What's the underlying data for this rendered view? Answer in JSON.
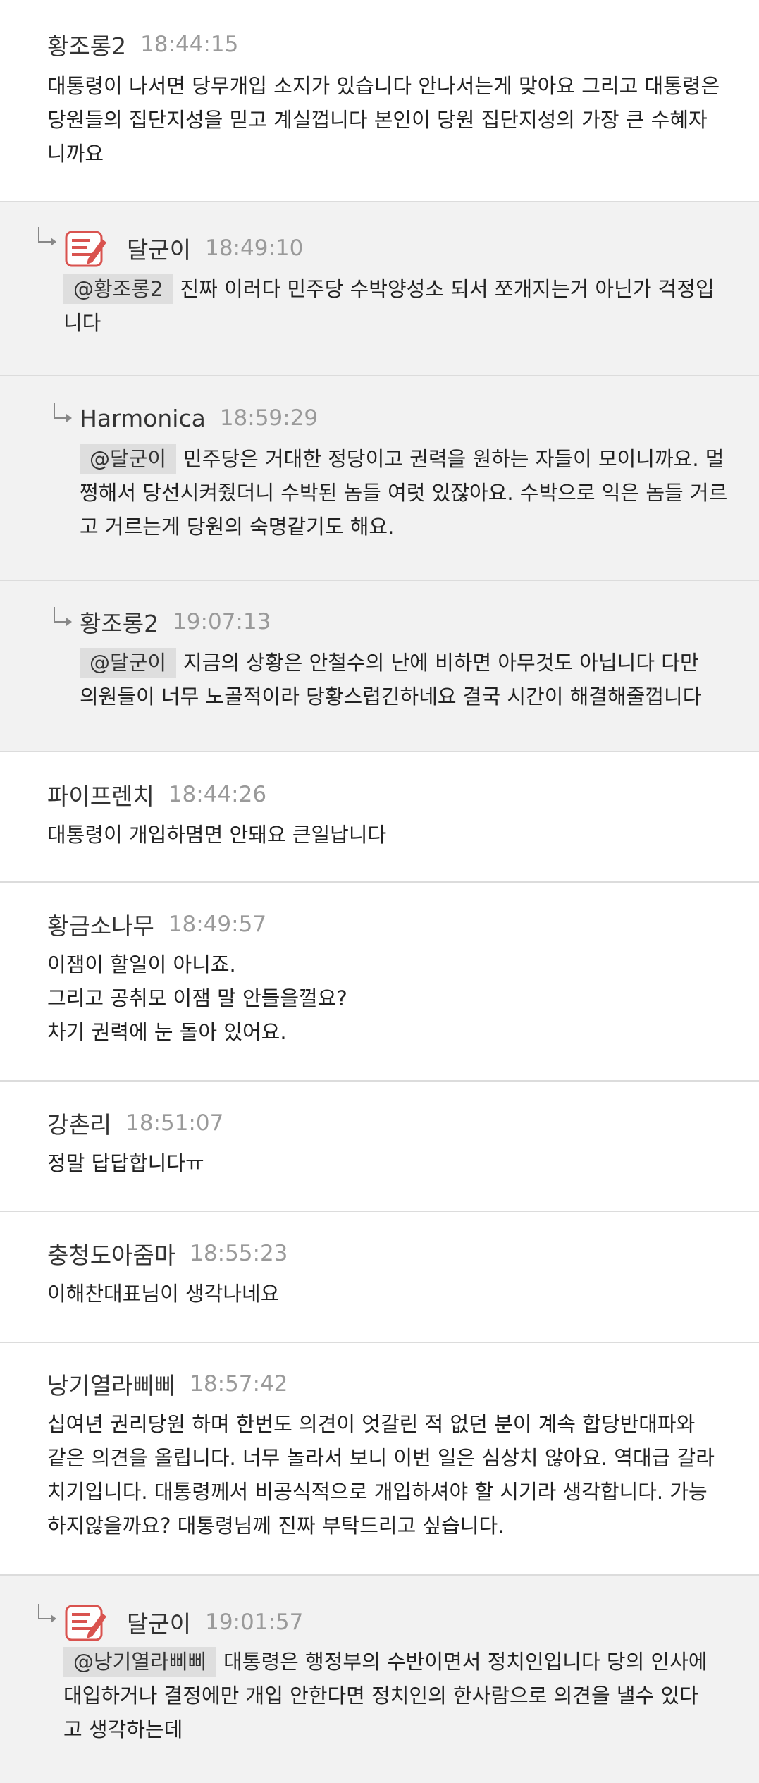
{
  "read_progress": 0.454,
  "accent_color": "#1eaa3b",
  "comments": [
    {
      "author": "황조롱2",
      "time": "18:44:15",
      "lines": [
        "대통령이 나서면 당무개입 소지가 있습니다 안나서는게 맞아요 그리고 대통령은",
        "당원들의 집단지성을 믿고 계실껍니다 본인이 당원 집단지성의 가장 큰 수혜자",
        "니까요"
      ]
    },
    {
      "author": "달군이",
      "badge_icon": "author-badge-icon",
      "time": "18:49:10",
      "mention": "@황조롱2",
      "first_line": "진짜 이러다 민주당 수박양성소 되서 쪼개지는거 아닌가 걱정입",
      "lines": [
        "니다"
      ]
    },
    {
      "author": "Harmonica",
      "time": "18:59:29",
      "mention": "@달군이",
      "first_line": "민주당은 거대한 정당이고 권력을 원하는 자들이 모이니까요. 멀",
      "lines": [
        "쩡해서 당선시켜줬더니 수박된 놈들 여럿 있잖아요. 수박으로 익은 놈들 거르",
        "고 거르는게 당원의 숙명같기도 해요."
      ]
    },
    {
      "author": "황조롱2",
      "time": "19:07:13",
      "mention": "@달군이",
      "first_line": "지금의 상황은 안철수의 난에 비하면 아무것도 아닙니다 다만",
      "lines": [
        "의원들이 너무 노골적이라 당황스럽긴하네요 결국 시간이 해결해줄껍니다"
      ]
    },
    {
      "author": "파이프렌치",
      "time": "18:44:26",
      "lines": [
        "대통령이 개입하몀면 안돼요 큰일납니다"
      ]
    },
    {
      "author": "황금소나무",
      "time": "18:49:57",
      "lines": [
        "이잼이 할일이 아니죠.",
        "그리고 공취모 이잼 말 안들을껄요?",
        "차기 권력에 눈 돌아 있어요."
      ]
    },
    {
      "author": "강촌리",
      "time": "18:51:07",
      "lines": [
        "정말 답답합니다ㅠ"
      ]
    },
    {
      "author": "충청도아줌마",
      "time": "18:55:23",
      "lines": [
        "이해찬대표님이 생각나네요"
      ]
    },
    {
      "author": "낭기열라삐삐",
      "time": "18:57:42",
      "lines": [
        "십여년 권리당원 하며 한번도 의견이 엇갈린 적 없던 분이 계속 합당반대파와",
        "같은 의견을 올립니다. 너무 놀라서 보니 이번 일은 심상치 않아요. 역대급 갈라",
        "치기입니다. 대통령께서 비공식적으로 개입하셔야 할 시기라 생각합니다. 가능",
        "하지않을까요? 대통령님께 진짜 부탁드리고 싶습니다."
      ]
    },
    {
      "author": "달군이",
      "badge_icon": "author-badge-icon",
      "time": "19:01:57",
      "mention": "@낭기열라삐삐",
      "first_line": "대통령은 행정부의 수반이면서 정치인입니다 당의 인사에",
      "lines": [
        "대입하거나 결정에만 개입 안한다면 정치인의 한사람으로 의견을 낼수 있다",
        "고 생각하는데"
      ]
    }
  ]
}
